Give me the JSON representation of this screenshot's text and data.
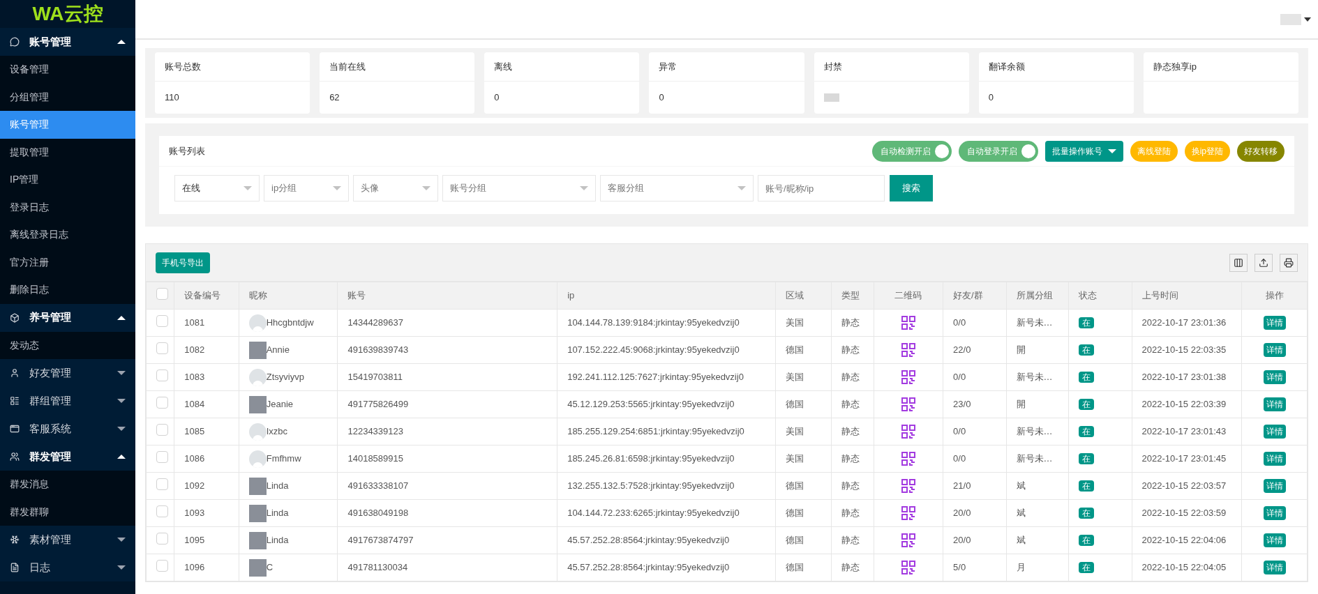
{
  "sidebar": {
    "logo": "WA云控",
    "groups": [
      {
        "label": "账号管理",
        "expanded": true,
        "items": [
          {
            "label": "设备管理",
            "selected": false
          },
          {
            "label": "分组管理",
            "selected": false
          },
          {
            "label": "账号管理",
            "selected": true
          },
          {
            "label": "提取管理",
            "selected": false
          },
          {
            "label": "IP管理",
            "selected": false
          },
          {
            "label": "登录日志",
            "selected": false
          },
          {
            "label": "离线登录日志",
            "selected": false
          },
          {
            "label": "官方注册",
            "selected": false
          },
          {
            "label": "删除日志",
            "selected": false
          }
        ]
      },
      {
        "label": "养号管理",
        "expanded": true,
        "items": [
          {
            "label": "发动态",
            "selected": false
          }
        ]
      },
      {
        "label": "好友管理",
        "expanded": false
      },
      {
        "label": "群组管理",
        "expanded": false
      },
      {
        "label": "客服系统",
        "expanded": false
      },
      {
        "label": "群发管理",
        "expanded": true,
        "items": [
          {
            "label": "群发消息",
            "selected": false
          },
          {
            "label": "群发群聊",
            "selected": false
          }
        ]
      },
      {
        "label": "素材管理",
        "expanded": false
      },
      {
        "label": "日志",
        "expanded": false
      }
    ]
  },
  "stats": [
    {
      "label": "账号总数",
      "value": "110"
    },
    {
      "label": "当前在线",
      "value": "62"
    },
    {
      "label": "离线",
      "value": "0"
    },
    {
      "label": "异常",
      "value": "0"
    },
    {
      "label": "封禁",
      "redacted": true
    },
    {
      "label": "翻译余额",
      "value": "0"
    },
    {
      "label": "静态独享ip"
    }
  ],
  "account_list": {
    "title": "账号列表",
    "actions": [
      {
        "kind": "toggle",
        "label": "自动检测开启",
        "on": true
      },
      {
        "kind": "toggle",
        "label": "自动登录开启",
        "on": true
      },
      {
        "kind": "dropdown",
        "label": "批量操作账号"
      },
      {
        "kind": "pill",
        "label": "离线登陆",
        "color": "#ffb800"
      },
      {
        "kind": "pill",
        "label": "换ip登陆",
        "color": "#ffb800"
      },
      {
        "kind": "pill",
        "label": "好友转移",
        "color": "#868600"
      }
    ],
    "filters": [
      {
        "kind": "select",
        "value": "在线"
      },
      {
        "kind": "select",
        "placeholder": "ip分组"
      },
      {
        "kind": "select",
        "placeholder": "头像"
      },
      {
        "kind": "select",
        "placeholder": "账号分组"
      },
      {
        "kind": "select",
        "placeholder": "客服分组"
      },
      {
        "kind": "input",
        "placeholder": "账号/昵称/ip"
      }
    ],
    "search_button": "搜索"
  },
  "table": {
    "export_button": "手机号导出",
    "header_checked": false,
    "columns": [
      "设备编号",
      "昵称",
      "账号",
      "ip",
      "区域",
      "类型",
      "二维码",
      "好友/群",
      "所属分组",
      "状态",
      "上号时间",
      "操作"
    ],
    "rows": [
      {
        "checked": false,
        "id": "1081",
        "avatar_photo": false,
        "nickname": "Hhcgbntdjw",
        "account": "14344289637",
        "ip": "104.144.78.139:9184:jrkintay:95yekedvzij0",
        "region": "美国",
        "type": "静态",
        "friends": "0/0",
        "group": "新号未…",
        "status": "在",
        "time": "2022-10-17 23:01:36",
        "action": "详情"
      },
      {
        "checked": false,
        "id": "1082",
        "avatar_photo": true,
        "nickname": "Annie",
        "account": "491639839743",
        "ip": "107.152.222.45:9068:jrkintay:95yekedvzij0",
        "region": "德国",
        "type": "静态",
        "friends": "22/0",
        "group": "開",
        "status": "在",
        "time": "2022-10-15 22:03:35",
        "action": "详情"
      },
      {
        "checked": false,
        "id": "1083",
        "avatar_photo": false,
        "nickname": "Ztsyviyvp",
        "account": "15419703811",
        "ip": "192.241.112.125:7627:jrkintay:95yekedvzij0",
        "region": "美国",
        "type": "静态",
        "friends": "0/0",
        "group": "新号未…",
        "status": "在",
        "time": "2022-10-17 23:01:38",
        "action": "详情"
      },
      {
        "checked": false,
        "id": "1084",
        "avatar_photo": true,
        "nickname": "Jeanie",
        "account": "491775826499",
        "ip": "45.12.129.253:5565:jrkintay:95yekedvzij0",
        "region": "德国",
        "type": "静态",
        "friends": "23/0",
        "group": "開",
        "status": "在",
        "time": "2022-10-15 22:03:39",
        "action": "详情"
      },
      {
        "checked": false,
        "id": "1085",
        "avatar_photo": false,
        "nickname": "Ixzbc",
        "account": "12234339123",
        "ip": "185.255.129.254:6851:jrkintay:95yekedvzij0",
        "region": "美国",
        "type": "静态",
        "friends": "0/0",
        "group": "新号未…",
        "status": "在",
        "time": "2022-10-17 23:01:43",
        "action": "详情"
      },
      {
        "checked": false,
        "id": "1086",
        "avatar_photo": false,
        "nickname": "Fmfhmw",
        "account": "14018589915",
        "ip": "185.245.26.81:6598:jrkintay:95yekedvzij0",
        "region": "美国",
        "type": "静态",
        "friends": "0/0",
        "group": "新号未…",
        "status": "在",
        "time": "2022-10-17 23:01:45",
        "action": "详情"
      },
      {
        "checked": false,
        "id": "1092",
        "avatar_photo": true,
        "nickname": "Linda",
        "account": "491633338107",
        "ip": "132.255.132.5:7528:jrkintay:95yekedvzij0",
        "region": "德国",
        "type": "静态",
        "friends": "21/0",
        "group": "斌",
        "status": "在",
        "time": "2022-10-15 22:03:57",
        "action": "详情"
      },
      {
        "checked": false,
        "id": "1093",
        "avatar_photo": true,
        "nickname": "Linda",
        "account": "491638049198",
        "ip": "104.144.72.233:6265:jrkintay:95yekedvzij0",
        "region": "德国",
        "type": "静态",
        "friends": "20/0",
        "group": "斌",
        "status": "在",
        "time": "2022-10-15 22:03:59",
        "action": "详情"
      },
      {
        "checked": false,
        "id": "1095",
        "avatar_photo": true,
        "nickname": "Linda",
        "account": "4917673874797",
        "ip": "45.57.252.28:8564:jrkintay:95yekedvzij0",
        "region": "德国",
        "type": "静态",
        "friends": "20/0",
        "group": "斌",
        "status": "在",
        "time": "2022-10-15 22:04:06",
        "action": "详情"
      },
      {
        "checked": false,
        "id": "1096",
        "avatar_photo": true,
        "nickname": "C",
        "account": "491781130034",
        "ip": "45.57.252.28:8564:jrkintay:95yekedvzij0",
        "region": "德国",
        "type": "静态",
        "friends": "5/0",
        "group": "月",
        "status": "在",
        "time": "2022-10-15 22:04:05",
        "action": "详情"
      }
    ]
  }
}
